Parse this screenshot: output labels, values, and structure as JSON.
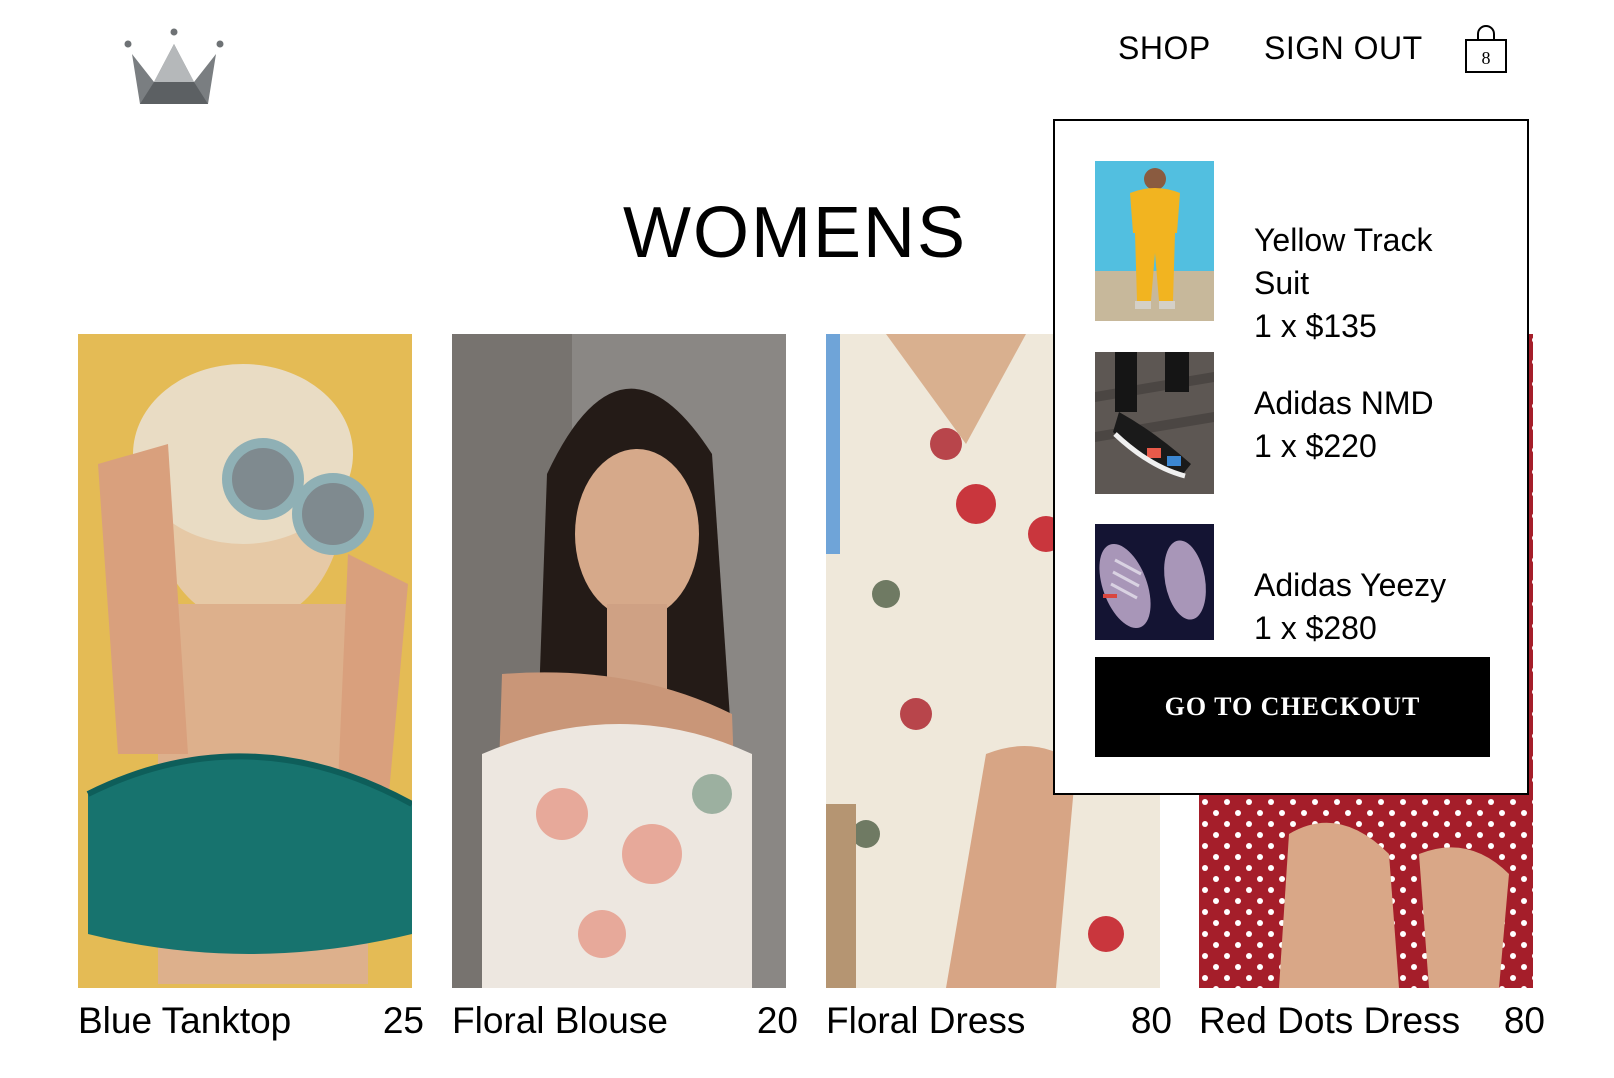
{
  "header": {
    "logo_icon": "crown-icon",
    "nav": {
      "shop": "SHOP",
      "sign_out": "SIGN OUT"
    },
    "cart": {
      "icon": "shopping-bag-icon",
      "count": "8"
    }
  },
  "page": {
    "title": "WOMENS"
  },
  "products": [
    {
      "name": "Blue Tanktop",
      "price": "25",
      "image": "woman with round sunglasses and teal crop top"
    },
    {
      "name": "Floral Blouse",
      "price": "20",
      "image": "woman in off-shoulder floral blouse"
    },
    {
      "name": "Floral Dress",
      "price": "80",
      "image": "white floral wrap dress"
    },
    {
      "name": "Red Dots Dress",
      "price": "80",
      "image": "red polka-dot dress"
    }
  ],
  "cart_dropdown": {
    "items": [
      {
        "name": "Yellow Track Suit",
        "quantity_price": "1 x $135"
      },
      {
        "name": "Adidas NMD",
        "quantity_price": "1 x $220"
      },
      {
        "name": "Adidas Yeezy",
        "quantity_price": "1 x $280"
      }
    ],
    "checkout_label": "GO TO CHECKOUT"
  },
  "colors": {
    "background": "#ffffff",
    "text": "#000000",
    "button": "#000000",
    "button_text": "#ffffff",
    "logo": "#6e7275"
  }
}
